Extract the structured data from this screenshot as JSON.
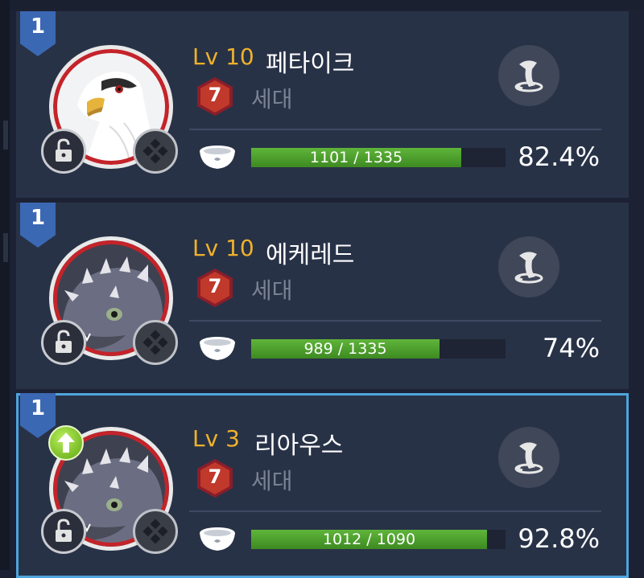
{
  "cards": [
    {
      "rank": "1",
      "level": "Lv 10",
      "name": "페타이크",
      "generation": "7",
      "generation_label": "세대",
      "exp": "1101 / 1335",
      "exp_fraction": 0.8247,
      "percent": "82.4%",
      "portrait": "eagle-portrait",
      "selected": false
    },
    {
      "rank": "1",
      "level": "Lv 10",
      "name": "에케레드",
      "generation": "7",
      "generation_label": "세대",
      "exp": "989 / 1335",
      "exp_fraction": 0.7408,
      "percent": "74%",
      "portrait": "lizard-portrait",
      "selected": false
    },
    {
      "rank": "1",
      "level": "Lv 3",
      "name": "리아우스",
      "generation": "7",
      "generation_label": "세대",
      "exp": "1012 / 1090",
      "exp_fraction": 0.9284,
      "percent": "92.8%",
      "portrait": "lizard-portrait",
      "selected": true,
      "upgrade_badge": "arrow-up-icon"
    }
  ],
  "colors": {
    "level": "#f0b12a",
    "bar_fill": "#4fa02e",
    "selected_border": "#4ea4dc",
    "generation_badge": "#c0392b"
  }
}
